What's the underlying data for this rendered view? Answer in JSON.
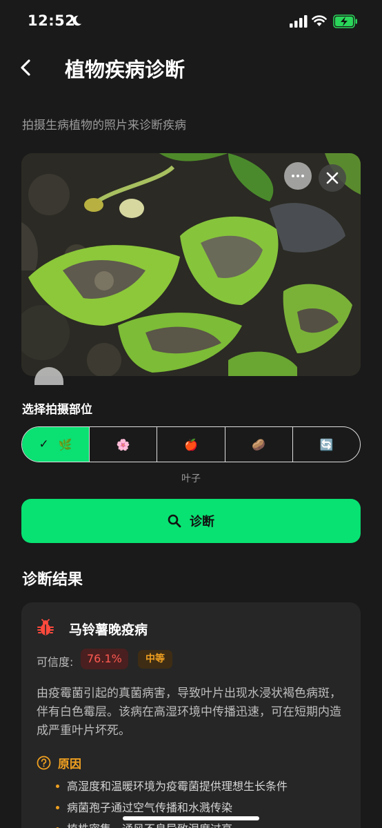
{
  "status_bar": {
    "time": "12:52"
  },
  "header": {
    "title": "植物疾病诊断"
  },
  "subtitle": "拍摄生病植物的照片来诊断疾病",
  "photo": {
    "alt": "生病的马铃薯叶片"
  },
  "part_selector": {
    "label": "选择拍摄部位",
    "options": [
      {
        "icon": "🌿",
        "selected": true
      },
      {
        "icon": "🌸",
        "selected": false
      },
      {
        "icon": "🍎",
        "selected": false
      },
      {
        "icon": "🥔",
        "selected": false
      },
      {
        "icon": "🔄",
        "selected": false
      }
    ],
    "selected_caption": "叶子"
  },
  "diagnose_button": {
    "label": "诊断"
  },
  "results": {
    "title": "诊断结果",
    "disease_name": "马铃薯晚疫病",
    "confidence_label": "可信度:",
    "confidence_value": "76.1%",
    "confidence_level": "中等",
    "description": "由疫霉菌引起的真菌病害，导致叶片出现水浸状褐色病斑，伴有白色霉层。该病在高湿环境中传播迅速，可在短期内造成严重叶片坏死。",
    "causes_title": "原因",
    "causes": [
      "高湿度和温暖环境为疫霉菌提供理想生长条件",
      "病菌孢子通过空气传播和水溅传染",
      "植株密集，通风不良导致湿度过高"
    ]
  },
  "colors": {
    "accent": "#08e272",
    "background": "#1a1a1a",
    "card": "#262626",
    "confidence_red": "#ff5a52",
    "warning_orange": "#f0a020"
  }
}
